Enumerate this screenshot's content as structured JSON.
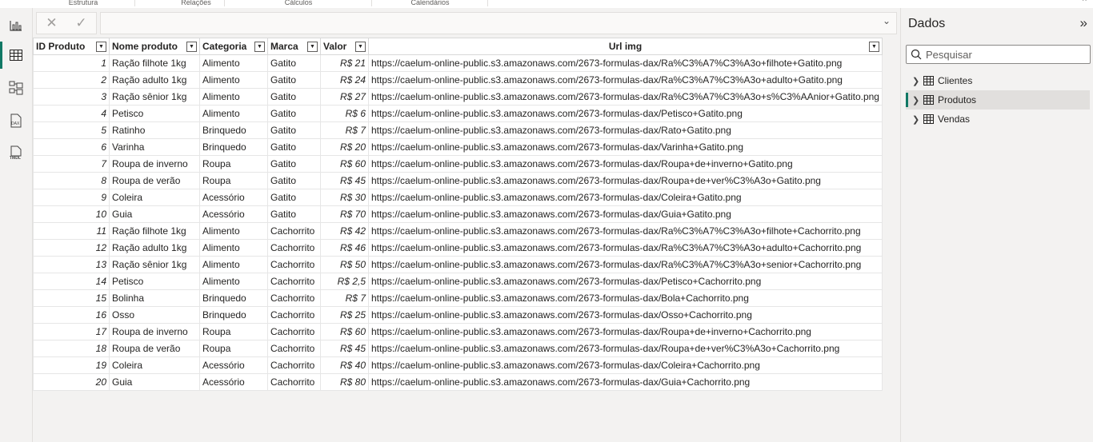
{
  "ribbon": {
    "groups": [
      "Estrutura",
      "Relações",
      "Cálculos",
      "Calendários"
    ]
  },
  "formula_bar": {
    "value": ""
  },
  "table": {
    "columns": [
      "ID Produto",
      "Nome produto",
      "Categoria",
      "Marca",
      "Valor",
      "Url img"
    ],
    "rows": [
      [
        "1",
        "Ração filhote 1kg",
        "Alimento",
        "Gatito",
        "R$ 21",
        "https://caelum-online-public.s3.amazonaws.com/2673-formulas-dax/Ra%C3%A7%C3%A3o+filhote+Gatito.png"
      ],
      [
        "2",
        "Ração adulto 1kg",
        "Alimento",
        "Gatito",
        "R$ 24",
        "https://caelum-online-public.s3.amazonaws.com/2673-formulas-dax/Ra%C3%A7%C3%A3o+adulto+Gatito.png"
      ],
      [
        "3",
        "Ração sênior 1kg",
        "Alimento",
        "Gatito",
        "R$ 27",
        "https://caelum-online-public.s3.amazonaws.com/2673-formulas-dax/Ra%C3%A7%C3%A3o+s%C3%AAnior+Gatito.png"
      ],
      [
        "4",
        "Petisco",
        "Alimento",
        "Gatito",
        "R$ 6",
        "https://caelum-online-public.s3.amazonaws.com/2673-formulas-dax/Petisco+Gatito.png"
      ],
      [
        "5",
        "Ratinho",
        "Brinquedo",
        "Gatito",
        "R$ 7",
        "https://caelum-online-public.s3.amazonaws.com/2673-formulas-dax/Rato+Gatito.png"
      ],
      [
        "6",
        "Varinha",
        "Brinquedo",
        "Gatito",
        "R$ 20",
        "https://caelum-online-public.s3.amazonaws.com/2673-formulas-dax/Varinha+Gatito.png"
      ],
      [
        "7",
        "Roupa de inverno",
        "Roupa",
        "Gatito",
        "R$ 60",
        "https://caelum-online-public.s3.amazonaws.com/2673-formulas-dax/Roupa+de+inverno+Gatito.png"
      ],
      [
        "8",
        "Roupa de verão",
        "Roupa",
        "Gatito",
        "R$ 45",
        "https://caelum-online-public.s3.amazonaws.com/2673-formulas-dax/Roupa+de+ver%C3%A3o+Gatito.png"
      ],
      [
        "9",
        "Coleira",
        "Acessório",
        "Gatito",
        "R$ 30",
        "https://caelum-online-public.s3.amazonaws.com/2673-formulas-dax/Coleira+Gatito.png"
      ],
      [
        "10",
        "Guia",
        "Acessório",
        "Gatito",
        "R$ 70",
        "https://caelum-online-public.s3.amazonaws.com/2673-formulas-dax/Guia+Gatito.png"
      ],
      [
        "11",
        "Ração filhote 1kg",
        "Alimento",
        "Cachorrito",
        "R$ 42",
        "https://caelum-online-public.s3.amazonaws.com/2673-formulas-dax/Ra%C3%A7%C3%A3o+filhote+Cachorrito.png"
      ],
      [
        "12",
        "Ração adulto 1kg",
        "Alimento",
        "Cachorrito",
        "R$ 46",
        "https://caelum-online-public.s3.amazonaws.com/2673-formulas-dax/Ra%C3%A7%C3%A3o+adulto+Cachorrito.png"
      ],
      [
        "13",
        "Ração sênior 1kg",
        "Alimento",
        "Cachorrito",
        "R$ 50",
        "https://caelum-online-public.s3.amazonaws.com/2673-formulas-dax/Ra%C3%A7%C3%A3o+senior+Cachorrito.png"
      ],
      [
        "14",
        "Petisco",
        "Alimento",
        "Cachorrito",
        "R$ 2,5",
        "https://caelum-online-public.s3.amazonaws.com/2673-formulas-dax/Petisco+Cachorrito.png"
      ],
      [
        "15",
        "Bolinha",
        "Brinquedo",
        "Cachorrito",
        "R$ 7",
        "https://caelum-online-public.s3.amazonaws.com/2673-formulas-dax/Bola+Cachorrito.png"
      ],
      [
        "16",
        "Osso",
        "Brinquedo",
        "Cachorrito",
        "R$ 25",
        "https://caelum-online-public.s3.amazonaws.com/2673-formulas-dax/Osso+Cachorrito.png"
      ],
      [
        "17",
        "Roupa de inverno",
        "Roupa",
        "Cachorrito",
        "R$ 60",
        "https://caelum-online-public.s3.amazonaws.com/2673-formulas-dax/Roupa+de+inverno+Cachorrito.png"
      ],
      [
        "18",
        "Roupa de verão",
        "Roupa",
        "Cachorrito",
        "R$ 45",
        "https://caelum-online-public.s3.amazonaws.com/2673-formulas-dax/Roupa+de+ver%C3%A3o+Cachorrito.png"
      ],
      [
        "19",
        "Coleira",
        "Acessório",
        "Cachorrito",
        "R$ 40",
        "https://caelum-online-public.s3.amazonaws.com/2673-formulas-dax/Coleira+Cachorrito.png"
      ],
      [
        "20",
        "Guia",
        "Acessório",
        "Cachorrito",
        "R$ 80",
        "https://caelum-online-public.s3.amazonaws.com/2673-formulas-dax/Guia+Cachorrito.png"
      ]
    ]
  },
  "data_pane": {
    "title": "Dados",
    "search_placeholder": "Pesquisar",
    "tables": [
      {
        "label": "Clientes",
        "selected": false
      },
      {
        "label": "Produtos",
        "selected": true
      },
      {
        "label": "Vendas",
        "selected": false
      }
    ]
  },
  "colors": {
    "accent": "#117865"
  }
}
